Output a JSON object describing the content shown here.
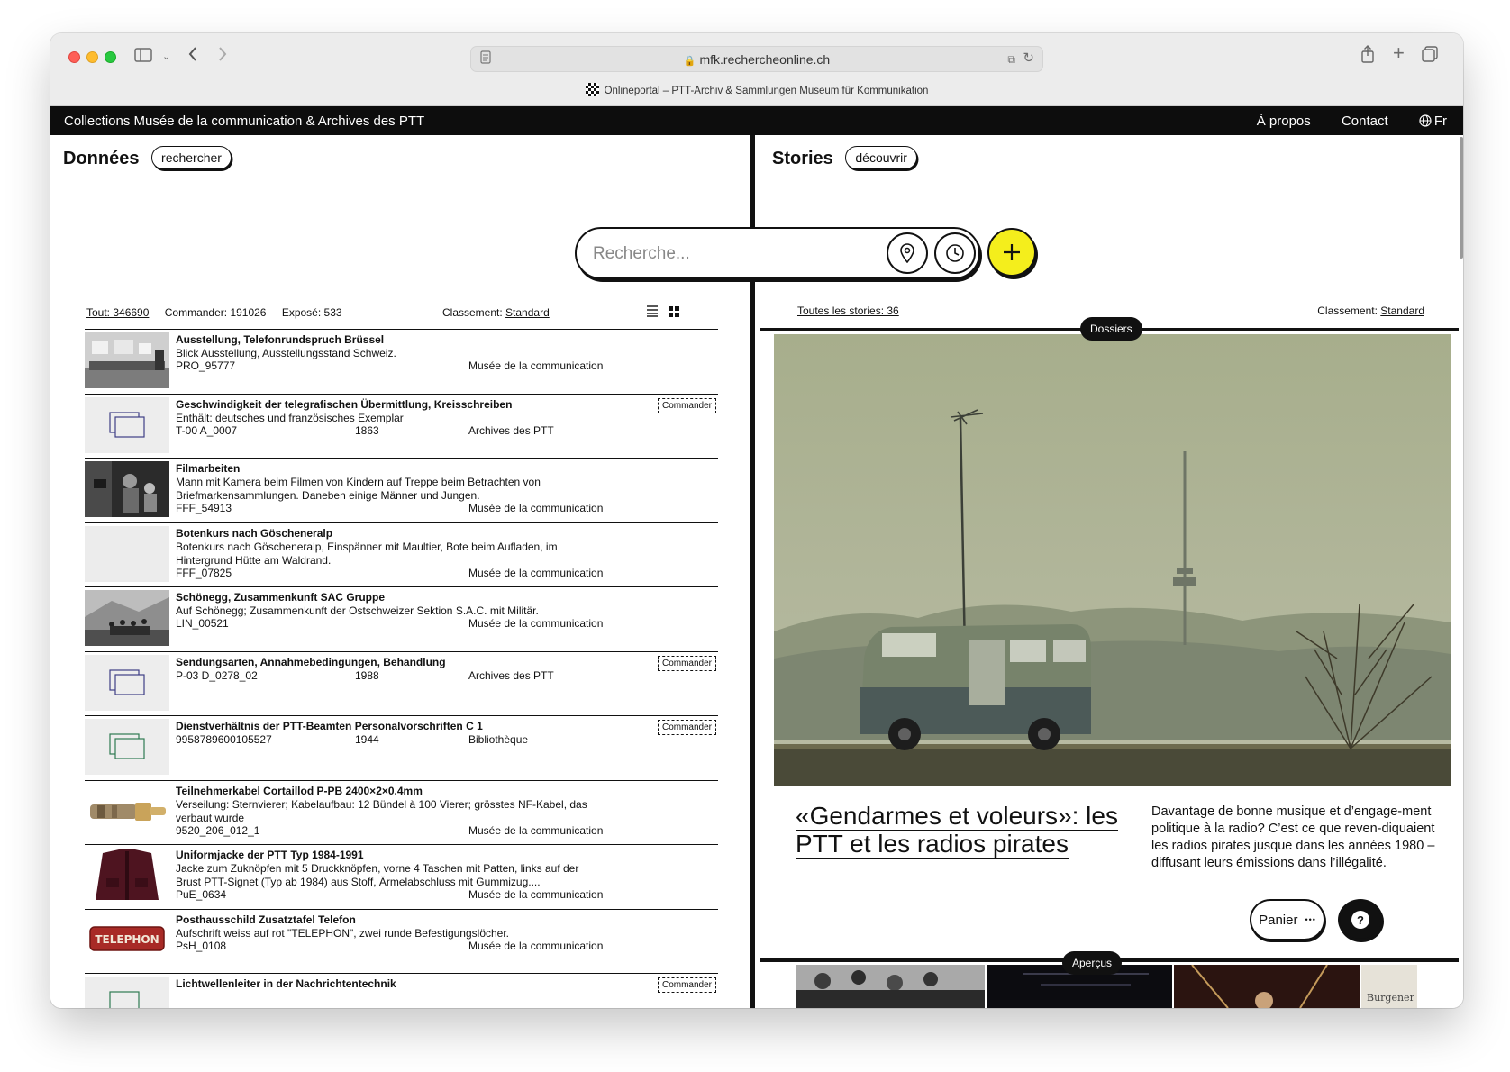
{
  "browser": {
    "url": "mfk.rechercheonline.ch",
    "tab_title": "Onlineportal – PTT-Archiv & Sammlungen Museum für Kommunikation"
  },
  "header": {
    "title": "Collections Musée de la communication & Archives des PTT",
    "nav": {
      "about": "À propos",
      "contact": "Contact",
      "lang": "Fr"
    }
  },
  "left": {
    "heading": "Données",
    "pill": "rechercher",
    "search_placeholder": "Recherche...",
    "stats": {
      "all": "Tout: 346690",
      "order": "Commander: 191026",
      "exposed": "Exposé: 533",
      "sort_label": "Classement:",
      "sort_value": "Standard"
    },
    "results": [
      {
        "title": "Ausstellung, Telefonrundspruch Brüssel",
        "desc": "Blick Ausstellung, Ausstellungsstand Schweiz.",
        "id": "PRO_95777",
        "year": "",
        "source": "Musée de la communication",
        "commander": ""
      },
      {
        "title": "Geschwindigkeit der telegrafischen Übermittlung, Kreisschreiben",
        "desc": "Enthält: deutsches und französisches Exemplar",
        "id": "T-00 A_0007",
        "year": "1863",
        "source": "Archives des PTT",
        "commander": "Commander"
      },
      {
        "title": "Filmarbeiten",
        "desc": "Mann mit Kamera beim Filmen von Kindern auf Treppe beim Betrachten von Briefmarkensammlungen. Daneben einige Männer und Jungen.",
        "id": "FFF_54913",
        "year": "",
        "source": "Musée de la communication",
        "commander": ""
      },
      {
        "title": "Botenkurs nach Göscheneralp",
        "desc": "Botenkurs nach Göscheneralp, Einspänner mit Maultier, Bote beim Aufladen, im Hintergrund Hütte am Waldrand.",
        "id": "FFF_07825",
        "year": "",
        "source": "Musée de la communication",
        "commander": ""
      },
      {
        "title": "Schönegg, Zusammenkunft SAC Gruppe",
        "desc": "Auf Schönegg; Zusammenkunft der Ostschweizer Sektion S.A.C. mit Militär.",
        "id": "LIN_00521",
        "year": "",
        "source": "Musée de la communication",
        "commander": ""
      },
      {
        "title": "Sendungsarten, Annahmebedingungen, Behandlung",
        "desc": "",
        "id": "P-03 D_0278_02",
        "year": "1988",
        "source": "Archives des PTT",
        "commander": "Commander"
      },
      {
        "title": "Dienstverhältnis der PTT-Beamten Personalvorschriften C 1",
        "desc": "",
        "id": "9958789600105527",
        "year": "1944",
        "source": "Bibliothèque",
        "commander": "Commander"
      },
      {
        "title": "Teilnehmerkabel Cortaillod P-PB 2400×2×0.4mm",
        "desc": "Verseilung: Sternvierer; Kabelaufbau: 12 Bündel à 100 Vierer; grösstes NF-Kabel, das verbaut wurde",
        "id": "9520_206_012_1",
        "year": "",
        "source": "Musée de la communication",
        "commander": ""
      },
      {
        "title": "Uniformjacke der PTT Typ 1984-1991",
        "desc": "Jacke zum Zuknöpfen mit 5 Druckknöpfen, vorne 4 Taschen mit Patten, links auf der Brust PTT-Signet (Typ ab 1984) aus Stoff, Ärmelabschluss mit Gummizug....",
        "id": "PuE_0634",
        "year": "",
        "source": "Musée de la communication",
        "commander": ""
      },
      {
        "title": "Posthausschild Zusatztafel Telefon",
        "desc": "Aufschrift weiss auf rot \"TELEPHON\", zwei runde Befestigungslöcher.",
        "id": "PsH_0108",
        "year": "",
        "source": "Musée de la communication",
        "commander": ""
      },
      {
        "title": "Lichtwellenleiter in der Nachrichtentechnik",
        "desc": "",
        "id": "",
        "year": "",
        "source": "",
        "commander": "Commander"
      }
    ],
    "telephon_sign": "TELEPHON"
  },
  "right": {
    "heading": "Stories",
    "pill": "découvrir",
    "stats": {
      "all": "Toutes les stories: 36",
      "sort_label": "Classement:",
      "sort_value": "Standard"
    },
    "badge_dossiers": "Dossiers",
    "badge_apercus": "Aperçus",
    "story": {
      "title": "«Gendarmes et voleurs»: les PTT et les radios pirates",
      "text": "Davantage de bonne musique et d’engage-ment politique à la radio? C’est ce que reven-diquaient les radios pirates jusque dans les années 1980 – diffusant leurs émissions dans l’illégalité."
    },
    "preview_caption": "Burgener",
    "cart_label": "Panier",
    "cart_more": "•••",
    "help_label": "?"
  },
  "icons": {
    "sidebar": "sidebar-icon",
    "back": "chevron-left-icon",
    "forward": "chevron-right-icon",
    "share": "share-icon",
    "new_tab": "plus-icon",
    "tabs": "tabs-overview-icon",
    "location": "location-pin-icon",
    "clock": "clock-icon",
    "add": "plus-icon",
    "globe": "globe-icon",
    "list_view": "list-view-icon",
    "grid_view": "grid-view-icon"
  },
  "colors": {
    "accent_yellow": "#f4ee1c",
    "black": "#0d0d0d"
  }
}
